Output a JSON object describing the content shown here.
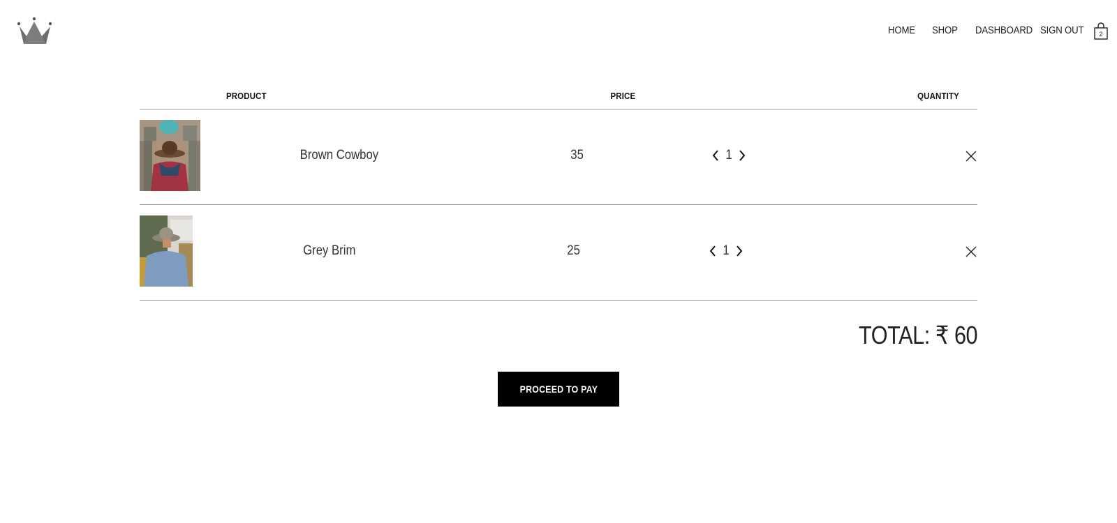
{
  "nav": {
    "links": [
      "HOME",
      "SHOP",
      "DASHBOARD",
      "SIGN OUT"
    ],
    "cart_count": "2",
    "logo_icon": "crown-icon",
    "cart_icon": "shopping-bag-icon"
  },
  "table": {
    "headers": {
      "product": "PRODUCT",
      "price": "PRICE",
      "quantity": "QUANTITY"
    },
    "rows": [
      {
        "name": "Brown Cowboy",
        "price": "35",
        "quantity": "1",
        "image": "brown-cowboy-hat-photo"
      },
      {
        "name": "Grey Brim",
        "price": "25",
        "quantity": "1",
        "image": "grey-brim-hat-photo"
      }
    ]
  },
  "total": {
    "text": "TOTAL: ₹ 60"
  },
  "checkout": {
    "button_label": "PROCEED TO PAY"
  },
  "colors": {
    "accent": "#000000",
    "rule": "#9a9a9a",
    "text": "#222222"
  }
}
